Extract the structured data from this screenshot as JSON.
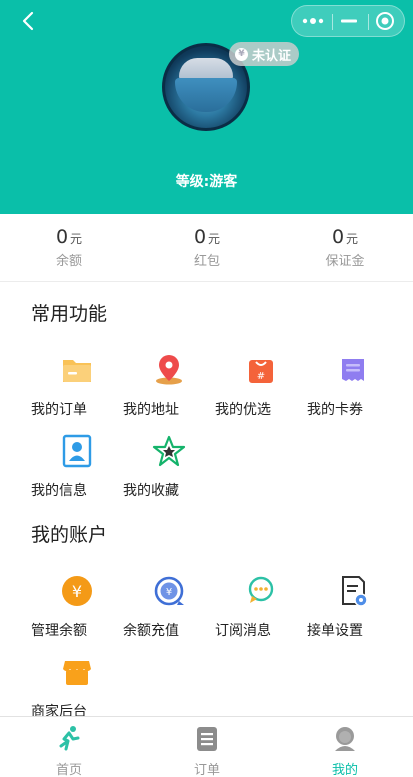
{
  "header": {
    "badge_text": "未认证",
    "level_text": "等级:游客",
    "bg_color": "#0abfa9"
  },
  "stats": [
    {
      "value": "0",
      "unit": "元",
      "label": "余额"
    },
    {
      "value": "0",
      "unit": "元",
      "label": "红包"
    },
    {
      "value": "0",
      "unit": "元",
      "label": "保证金"
    }
  ],
  "common": {
    "title": "常用功能",
    "items": [
      {
        "label": "我的订单",
        "icon": "folder-icon"
      },
      {
        "label": "我的地址",
        "icon": "location-pin-icon"
      },
      {
        "label": "我的优选",
        "icon": "shopping-bag-icon"
      },
      {
        "label": "我的卡券",
        "icon": "ticket-icon"
      },
      {
        "label": "我的信息",
        "icon": "profile-card-icon"
      },
      {
        "label": "我的收藏",
        "icon": "star-icon"
      }
    ]
  },
  "account": {
    "title": "我的账户",
    "items": [
      {
        "label": "管理余额",
        "icon": "yuan-coin-icon"
      },
      {
        "label": "余额充值",
        "icon": "recharge-icon"
      },
      {
        "label": "订阅消息",
        "icon": "chat-bubble-icon"
      },
      {
        "label": "接单设置",
        "icon": "document-settings-icon"
      },
      {
        "label": "商家后台",
        "icon": "store-icon"
      }
    ]
  },
  "tabbar": [
    {
      "label": "首页",
      "icon": "runner-icon",
      "active": false
    },
    {
      "label": "订单",
      "icon": "order-list-icon",
      "active": false
    },
    {
      "label": "我的",
      "icon": "user-avatar-icon",
      "active": true
    }
  ]
}
